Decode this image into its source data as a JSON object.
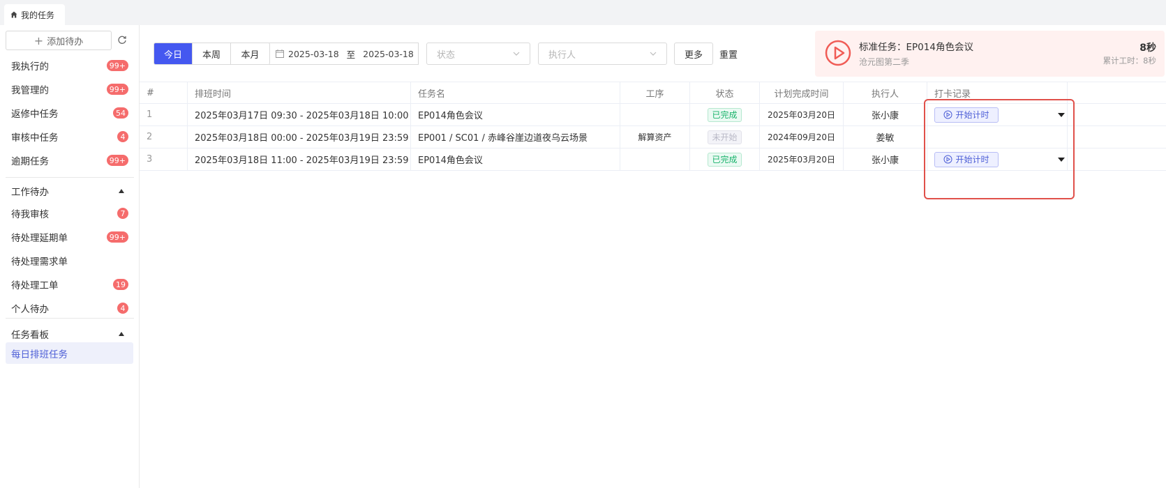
{
  "tabs": [
    {
      "label": "我的任务"
    }
  ],
  "sidebar": {
    "add_label": "添加待办",
    "items": [
      {
        "label": "我执行的",
        "badge": "99+"
      },
      {
        "label": "我管理的",
        "badge": "99+"
      },
      {
        "label": "返修中任务",
        "badge": "54"
      },
      {
        "label": "审核中任务",
        "badge": "4"
      },
      {
        "label": "逾期任务",
        "badge": "99+"
      }
    ],
    "work_section": {
      "label": "工作待办",
      "items": [
        {
          "label": "待我审核",
          "badge": "7"
        },
        {
          "label": "待处理延期单",
          "badge": "99+"
        },
        {
          "label": "待处理需求单",
          "badge": ""
        },
        {
          "label": "待处理工单",
          "badge": "19"
        },
        {
          "label": "个人待办",
          "badge": "4"
        }
      ]
    },
    "board_section": {
      "label": "任务看板",
      "items": [
        {
          "label": "每日排班任务",
          "active": true
        }
      ]
    }
  },
  "toolbar": {
    "periods": [
      "今日",
      "本周",
      "本月"
    ],
    "active_period": "今日",
    "date_start": "2025-03-18",
    "date_sep": "至",
    "date_end": "2025-03-18",
    "status_placeholder": "状态",
    "executor_placeholder": "执行人",
    "more_label": "更多",
    "reset_label": "重置"
  },
  "current_task": {
    "title": "标准任务：EP014角色会议",
    "project": "沧元图第二季",
    "elapsed": "8秒",
    "cumulative_label": "累计工时：",
    "cumulative_value": "8秒"
  },
  "table": {
    "columns": [
      "#",
      "排班时间",
      "任务名",
      "工序",
      "状态",
      "计划完成时间",
      "执行人",
      "打卡记录"
    ],
    "rows": [
      {
        "index": "1",
        "schedule": "2025年03月17日 09:30 - 2025年03月18日 10:00",
        "task": "EP014角色会议",
        "process": "",
        "status": "已完成",
        "status_type": "done",
        "due": "2025年03月20日",
        "executor": "张小康",
        "clock_label": "开始计时"
      },
      {
        "index": "2",
        "schedule": "2025年03月18日 00:00 - 2025年03月19日 23:59",
        "task": "EP001 / SC01 / 赤峰谷崖边道夜乌云场景",
        "process": "解算资产",
        "status": "未开始",
        "status_type": "notstarted",
        "due": "2024年09月20日",
        "executor": "姜敏",
        "clock_label": ""
      },
      {
        "index": "3",
        "schedule": "2025年03月18日 11:00 - 2025年03月19日 23:59",
        "task": "EP014角色会议",
        "process": "",
        "status": "已完成",
        "status_type": "done",
        "due": "2025年03月20日",
        "executor": "张小康",
        "clock_label": "开始计时"
      }
    ]
  },
  "colors": {
    "accent": "#4458f0",
    "badge": "#f56c6c",
    "highlight": "#e0504a",
    "done": "#19b36b"
  }
}
